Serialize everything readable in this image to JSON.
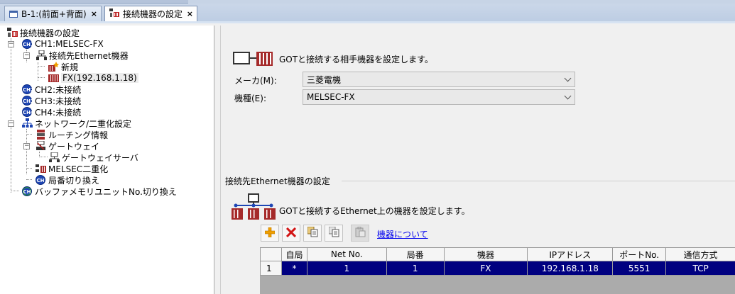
{
  "tabs": [
    {
      "label": "B-1:(前面+背面)",
      "close": "×",
      "active": false
    },
    {
      "label": "接続機器の設定",
      "close": "×",
      "active": true
    }
  ],
  "tree": {
    "root": "接続機器の設定",
    "ch1": "CH1:MELSEC-FX",
    "ethernet_devices": "接続先Ethernet機器",
    "new_item": "新規",
    "fx_device": "FX(192.168.1.18)",
    "ch2": "CH2:未接続",
    "ch3": "CH3:未接続",
    "ch4": "CH4:未接続",
    "network": "ネットワーク/二重化設定",
    "routing": "ルーチング情報",
    "gateway": "ゲートウェイ",
    "gateway_server": "ゲートウェイサーバ",
    "melsec_dual": "MELSEC二重化",
    "station_switch": "局番切り換え",
    "buffer_switch": "バッファメモリユニットNo.切り換え",
    "ch_badges": [
      "CH1",
      "CH2",
      "CH3",
      "CH4",
      "CH",
      "CH"
    ]
  },
  "main": {
    "intro": "GOTと接続する相手機器を設定します。",
    "maker_label": "メーカ(M):",
    "maker_value": "三菱電機",
    "model_label": "機種(E):",
    "model_value": "MELSEC-FX",
    "section_title": "接続先Ethernet機器の設定",
    "eth_intro": "GOTと接続するEthernet上の機器を設定します。",
    "toolbar": {
      "add": "add-icon",
      "delete": "delete-icon",
      "copy": "copy-icon",
      "paste": "paste-icon",
      "paste_disabled": "paste-disabled-icon"
    },
    "about_link": "機器について",
    "table": {
      "headers": [
        "自局",
        "Net No.",
        "局番",
        "機器",
        "IPアドレス",
        "ポートNo.",
        "通信方式"
      ],
      "rows": [
        {
          "num": "1",
          "cells": [
            "*",
            "1",
            "1",
            "FX",
            "192.168.1.18",
            "5551",
            "TCP"
          ]
        }
      ]
    }
  },
  "colors": {
    "selection": "#000080",
    "ch_badge": "#1e46b4",
    "link": "#0000ee"
  }
}
